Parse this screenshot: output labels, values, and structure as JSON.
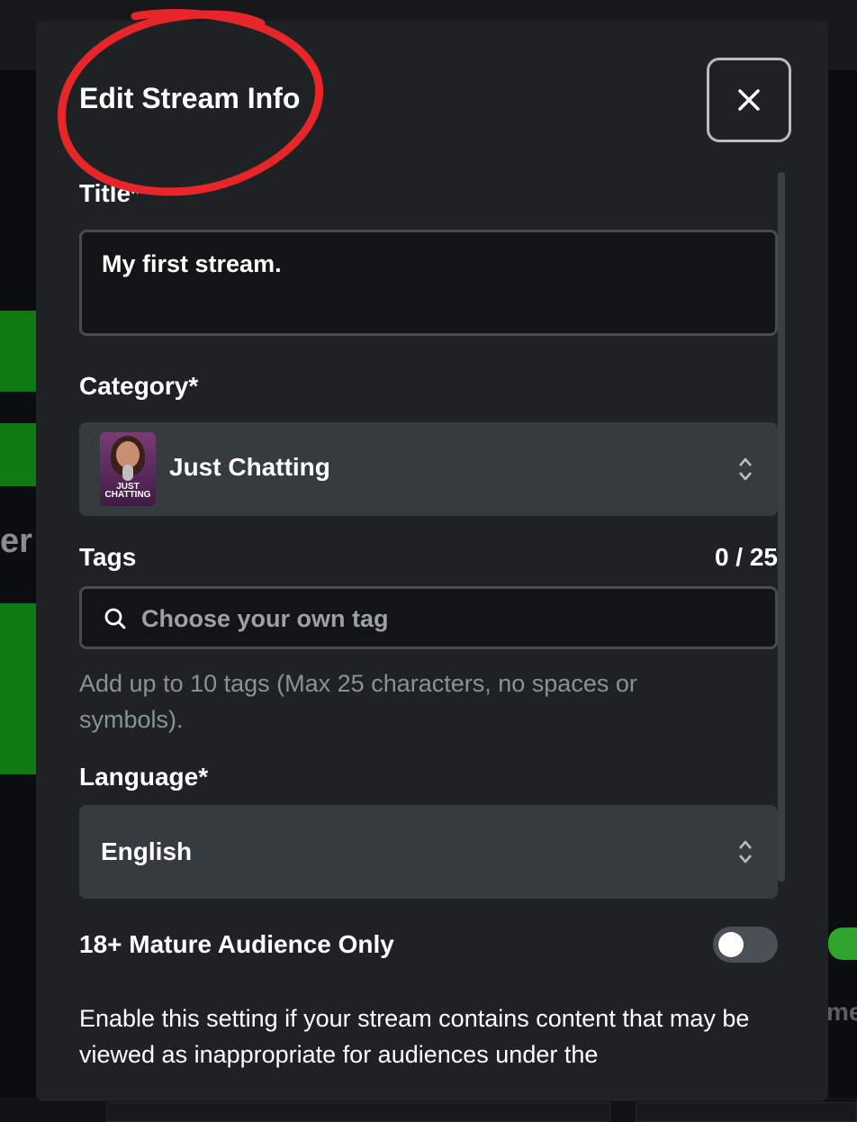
{
  "modal": {
    "title": "Edit Stream Info",
    "close_icon": "close-icon",
    "accent_color": "#e8262a"
  },
  "title_field": {
    "label": "Title*",
    "value": "My first stream."
  },
  "category_field": {
    "label": "Category*",
    "value": "Just Chatting",
    "thumbnail_text": "JUST CHATTING",
    "icon": "chevron-updown-icon"
  },
  "tags_field": {
    "label": "Tags",
    "counter": "0 / 25",
    "placeholder": "Choose your own tag",
    "helper": "Add up to 10 tags (Max 25 characters, no spaces or symbols).",
    "icon": "search-icon"
  },
  "language_field": {
    "label": "Language*",
    "value": "English",
    "icon": "chevron-updown-icon"
  },
  "mature_setting": {
    "label": "18+ Mature Audience Only",
    "enabled": false,
    "description": "Enable this setting if your stream contains content that may be viewed as inappropriate for audiences under the"
  }
}
